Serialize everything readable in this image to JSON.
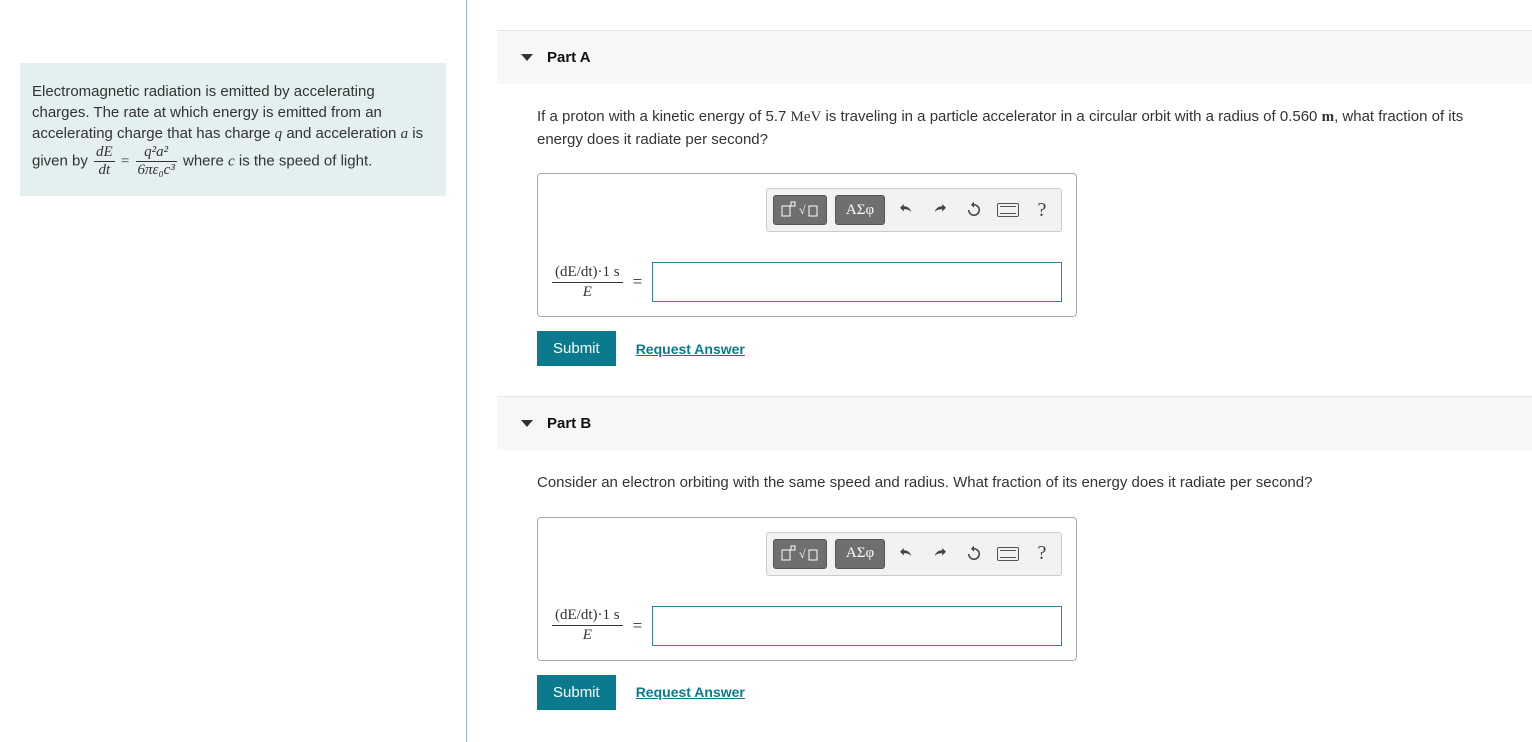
{
  "info": {
    "text_1": "Electromagnetic radiation is emitted by accelerating charges. The rate at which energy is emitted from an accelerating charge that has charge ",
    "var_q": "q",
    "text_2": " and acceleration ",
    "var_a": "a",
    "text_3": " is given by ",
    "frac_left_num": "dE",
    "frac_left_den": "dt",
    "equals": "=",
    "frac_right_num_html": "q²a²",
    "frac_right_den_html": "6πε₀c³",
    "text_4": " where ",
    "var_c": "c",
    "text_5": " is the speed of light."
  },
  "parts": {
    "a": {
      "label": "Part A",
      "prompt_pre": "If a proton with a kinetic energy of 5.7 ",
      "unit1": "MeV",
      "prompt_mid": " is traveling in a particle accelerator in a circular orbit with a radius of 0.560 ",
      "unit2": "m",
      "prompt_post": ", what fraction of its energy does it radiate per second?",
      "lhs_num": "(dE/dt)·1 s",
      "lhs_den": "E",
      "eq": "=",
      "submit": "Submit",
      "request": "Request Answer",
      "greek_label": "ΑΣφ",
      "help": "?"
    },
    "b": {
      "label": "Part B",
      "prompt": "Consider an electron orbiting with the same speed and radius. What fraction of its energy does it radiate per second?",
      "lhs_num": "(dE/dt)·1 s",
      "lhs_den": "E",
      "eq": "=",
      "submit": "Submit",
      "request": "Request Answer",
      "greek_label": "ΑΣφ",
      "help": "?"
    }
  }
}
